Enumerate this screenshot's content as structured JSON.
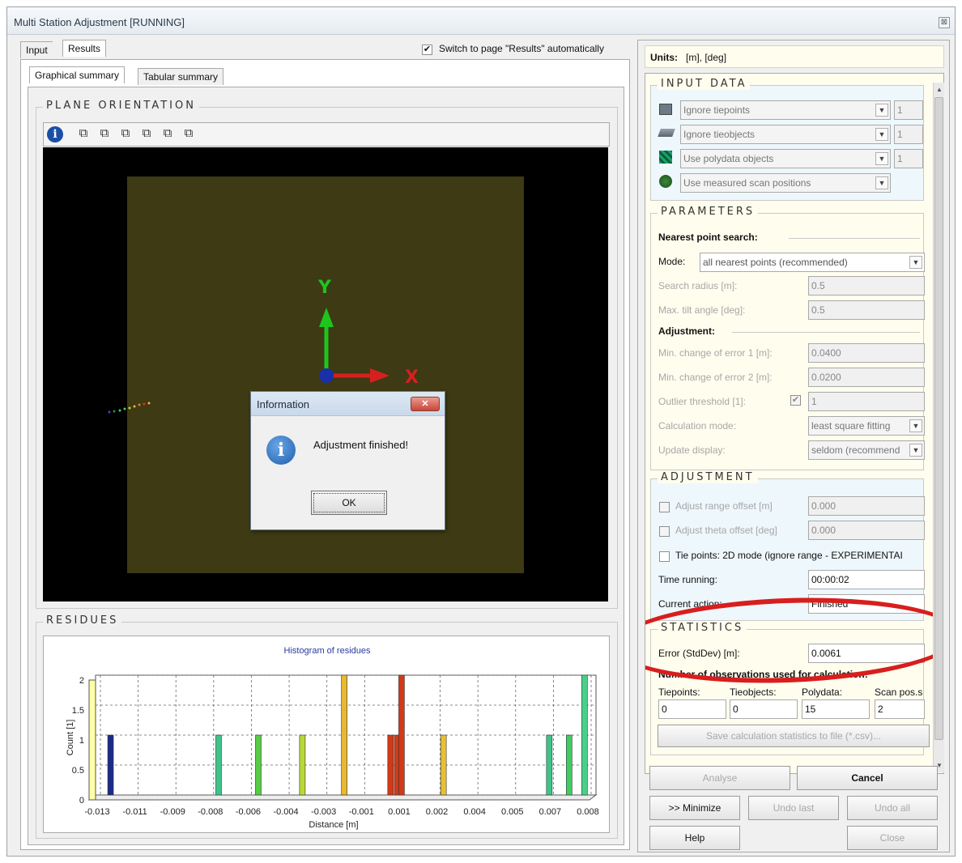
{
  "window": {
    "title": "Multi Station Adjustment [RUNNING]",
    "close_glyph": "⊠"
  },
  "tabs": {
    "main": [
      "Input",
      "Results"
    ],
    "sub": [
      "Graphical summary",
      "Tabular summary"
    ],
    "auto_switch_label": "Switch to page \"Results\" automatically",
    "auto_switch_checked": "✔"
  },
  "plane_orientation": {
    "title": "PLANE ORIENTATION",
    "info_glyph": "i",
    "axis_y": "Y",
    "axis_x": "X"
  },
  "dialog": {
    "title": "Information",
    "close_glyph": "✕",
    "icon_glyph": "i",
    "message": "Adjustment finished!",
    "ok": "OK"
  },
  "residues": {
    "title": "RESIDUES",
    "chart_data": {
      "type": "bar",
      "title": "Histogram of residues",
      "xlabel": "Distance [m]",
      "ylabel": "Count [1]",
      "ylim": [
        0,
        2
      ],
      "y_ticks": [
        "0",
        "0.5",
        "1",
        "1.5",
        "2"
      ],
      "x_ticks": [
        "-0.013",
        "-0.011",
        "-0.009",
        "-0.008",
        "-0.006",
        "-0.004",
        "-0.003",
        "-0.001",
        "0.001",
        "0.002",
        "0.004",
        "0.005",
        "0.007",
        "0.008"
      ],
      "bars": [
        {
          "x": -0.013,
          "value": 1,
          "color": "#1c2b8a"
        },
        {
          "x": -0.0081,
          "value": 1,
          "color": "#3ec48a"
        },
        {
          "x": -0.0063,
          "value": 1,
          "color": "#55cc44"
        },
        {
          "x": -0.0043,
          "value": 1,
          "color": "#b8d838"
        },
        {
          "x": -0.0024,
          "value": 2,
          "color": "#e8b830"
        },
        {
          "x": -0.0003,
          "value": 1,
          "color": "#d23a18"
        },
        {
          "x": 0.0,
          "value": 1,
          "color": "#d23a18"
        },
        {
          "x": 0.0002,
          "value": 2,
          "color": "#d23a18"
        },
        {
          "x": 0.0021,
          "value": 1,
          "color": "#e8c030"
        },
        {
          "x": 0.0069,
          "value": 1,
          "color": "#3ec48a"
        },
        {
          "x": 0.0078,
          "value": 1,
          "color": "#40cc60"
        },
        {
          "x": 0.0085,
          "value": 2,
          "color": "#48d088"
        }
      ],
      "xlim": [
        -0.0137,
        0.009
      ],
      "grid": true
    }
  },
  "right": {
    "units_label": "Units:",
    "units_value": "[m], [deg]",
    "input_data": {
      "title": "INPUT DATA",
      "rows": [
        {
          "icon": "tiepoints-icon",
          "value": "Ignore tiepoints",
          "count": "1"
        },
        {
          "icon": "tieobjects-icon",
          "value": "Ignore tieobjects",
          "count": "1"
        },
        {
          "icon": "polydata-icon",
          "value": "Use polydata objects",
          "count": "1"
        },
        {
          "icon": "scan-positions-icon",
          "value": "Use measured scan positions"
        }
      ]
    },
    "parameters": {
      "title": "PARAMETERS",
      "nearest_heading": "Nearest point search:",
      "mode_label": "Mode:",
      "mode_value": "all nearest points (recommended)",
      "search_radius_label": "Search radius [m]:",
      "search_radius": "0.5",
      "max_tilt_label": "Max. tilt angle [deg]:",
      "max_tilt": "0.5",
      "adjustment_heading": "Adjustment:",
      "min_change1_label": "Min. change of error 1 [m]:",
      "min_change1": "0.0400",
      "min_change2_label": "Min. change of error 2 [m]:",
      "min_change2": "0.0200",
      "outlier_label": "Outlier threshold [1]:",
      "outlier_checked": "✔",
      "outlier": "1",
      "calc_mode_label": "Calculation mode:",
      "calc_mode": "least square fitting",
      "update_label": "Update display:",
      "update": "seldom (recommend"
    },
    "adjustment": {
      "title": "ADJUSTMENT",
      "range_offset_label": "Adjust range offset [m]",
      "range_offset": "0.000",
      "theta_offset_label": "Adjust theta offset [deg]",
      "theta_offset": "0.000",
      "tie_points_label": "Tie points: 2D mode (ignore range - EXPERIMENTAI",
      "time_label": "Time running:",
      "time_value": "00:00:02",
      "action_label": "Current action:",
      "action_value": "Finished"
    },
    "statistics": {
      "title": "STATISTICS",
      "error_label": "Error (StdDev) [m]:",
      "error_value": "0.0061",
      "number_heading": "Number of observations used for calculation:",
      "cols": [
        {
          "label": "Tiepoints:",
          "value": "0"
        },
        {
          "label": "Tieobjects:",
          "value": "0"
        },
        {
          "label": "Polydata:",
          "value": "15"
        },
        {
          "label": "Scan pos.s",
          "value": "2"
        }
      ],
      "save_button": "Save calculation statistics to file (*.csv)..."
    },
    "buttons": {
      "analyse": "Analyse",
      "cancel": "Cancel",
      "minimize": ">> Minimize",
      "undo_last": "Undo last",
      "undo_all": "Undo all",
      "help": "Help",
      "close": "Close"
    },
    "scroll_up": "▲",
    "scroll_down": "▼"
  }
}
